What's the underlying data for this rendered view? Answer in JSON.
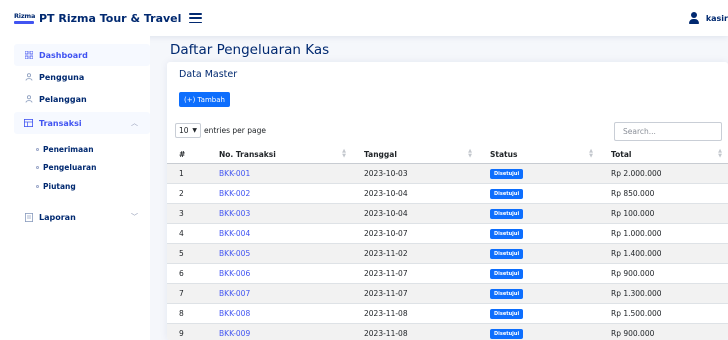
{
  "header": {
    "logo_text": "Rizma",
    "brand": "PT Rizma Tour & Travel",
    "user_name": "kasir"
  },
  "sidebar": {
    "items": [
      {
        "label": "Dashboard",
        "icon": "grid-icon"
      },
      {
        "label": "Pengguna",
        "icon": "person-icon"
      },
      {
        "label": "Pelanggan",
        "icon": "person-icon"
      },
      {
        "label": "Transaksi",
        "icon": "table-icon",
        "chevron": "^"
      },
      {
        "label": "Laporan",
        "icon": "file-icon",
        "chevron": "v"
      }
    ],
    "sub_items": [
      {
        "label": "Penerimaan"
      },
      {
        "label": "Pengeluaran"
      },
      {
        "label": "Piutang"
      }
    ]
  },
  "main": {
    "page_title": "Daftar Pengeluaran Kas",
    "card_title": "Data Master",
    "add_button": "(+) Tambah",
    "entries_value": "10",
    "entries_label": "entries per page",
    "search_placeholder": "Search..."
  },
  "table": {
    "columns": [
      "#",
      "No. Transaksi",
      "Tanggal",
      "Status",
      "Total"
    ],
    "rows": [
      [
        "1",
        "BKK-001",
        "2023-10-03",
        "Disetujui",
        "Rp 2.000.000"
      ],
      [
        "2",
        "BKK-002",
        "2023-10-04",
        "Disetujui",
        "Rp 850.000"
      ],
      [
        "3",
        "BKK-003",
        "2023-10-04",
        "Disetujui",
        "Rp 100.000"
      ],
      [
        "4",
        "BKK-004",
        "2023-10-07",
        "Disetujui",
        "Rp 1.000.000"
      ],
      [
        "5",
        "BKK-005",
        "2023-11-02",
        "Disetujui",
        "Rp 1.400.000"
      ],
      [
        "6",
        "BKK-006",
        "2023-11-07",
        "Disetujui",
        "Rp 900.000"
      ],
      [
        "7",
        "BKK-007",
        "2023-11-07",
        "Disetujui",
        "Rp 1.300.000"
      ],
      [
        "8",
        "BKK-008",
        "2023-11-08",
        "Disetujui",
        "Rp 1.500.000"
      ],
      [
        "9",
        "BKK-009",
        "2023-11-08",
        "Disetujui",
        "Rp 900.000"
      ]
    ]
  },
  "colors": {
    "primary": "#4154f1",
    "navy": "#012970",
    "badge": "#0d6efd",
    "background": "#f5f7fb"
  }
}
